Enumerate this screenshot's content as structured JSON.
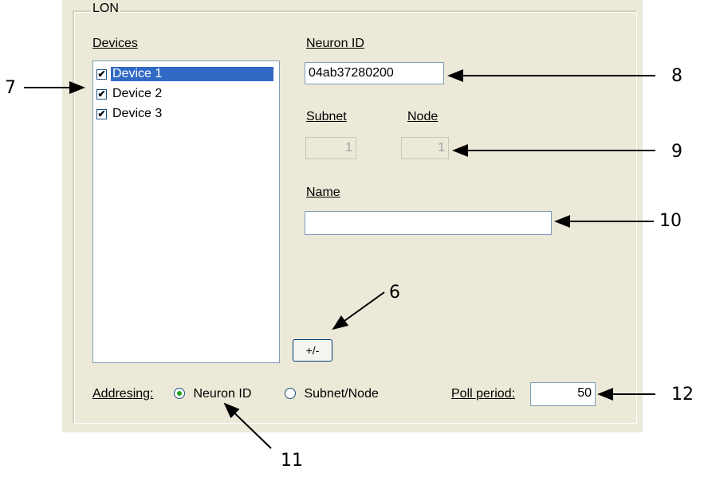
{
  "group": {
    "title": "LON"
  },
  "devices": {
    "label": "Devices",
    "items": [
      {
        "label": "Device 1",
        "checked": true,
        "selected": true
      },
      {
        "label": "Device 2",
        "checked": true,
        "selected": false
      },
      {
        "label": "Device 3",
        "checked": true,
        "selected": false
      }
    ]
  },
  "neuron_id": {
    "label": "Neuron ID",
    "value": "04ab37280200"
  },
  "subnet": {
    "label": "Subnet",
    "value": "1"
  },
  "node": {
    "label": "Node",
    "value": "1"
  },
  "name": {
    "label": "Name",
    "value": ""
  },
  "toggle_button": {
    "label": "+/-"
  },
  "addressing": {
    "label": "Addresing:",
    "options": [
      {
        "label": "Neuron ID",
        "selected": true
      },
      {
        "label": "Subnet/Node",
        "selected": false
      }
    ]
  },
  "poll_period": {
    "label": "Poll period:",
    "value": "50"
  },
  "callouts": [
    "6",
    "7",
    "8",
    "9",
    "10",
    "11",
    "12"
  ],
  "colors": {
    "selection": "#316ac5",
    "panel": "#ece9d8",
    "arrow": "#000000"
  }
}
